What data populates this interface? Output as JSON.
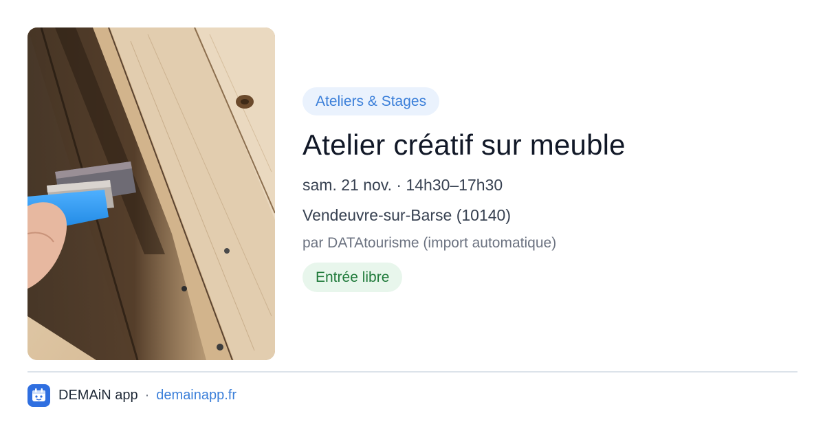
{
  "event": {
    "category": "Ateliers & Stages",
    "title": "Atelier créatif sur meuble",
    "datetime": "sam. 21 nov. · 14h30–17h30",
    "location": "Vendeuvre-sur-Barse (10140)",
    "source": "par DATAtourisme (import automatique)",
    "price": "Entrée libre",
    "image_icon": "paintbrush-on-wood-photo"
  },
  "footer": {
    "app_name": "DEMAiN app",
    "separator": "·",
    "url": "demainapp.fr",
    "logo_icon": "demain-logo-icon"
  },
  "colors": {
    "category_bg": "#eaf2fd",
    "category_text": "#3b7fd9",
    "price_bg": "#e8f6ec",
    "price_text": "#1f7a3a",
    "link": "#3b7fd9",
    "logo_bg": "#2f6fe0"
  }
}
